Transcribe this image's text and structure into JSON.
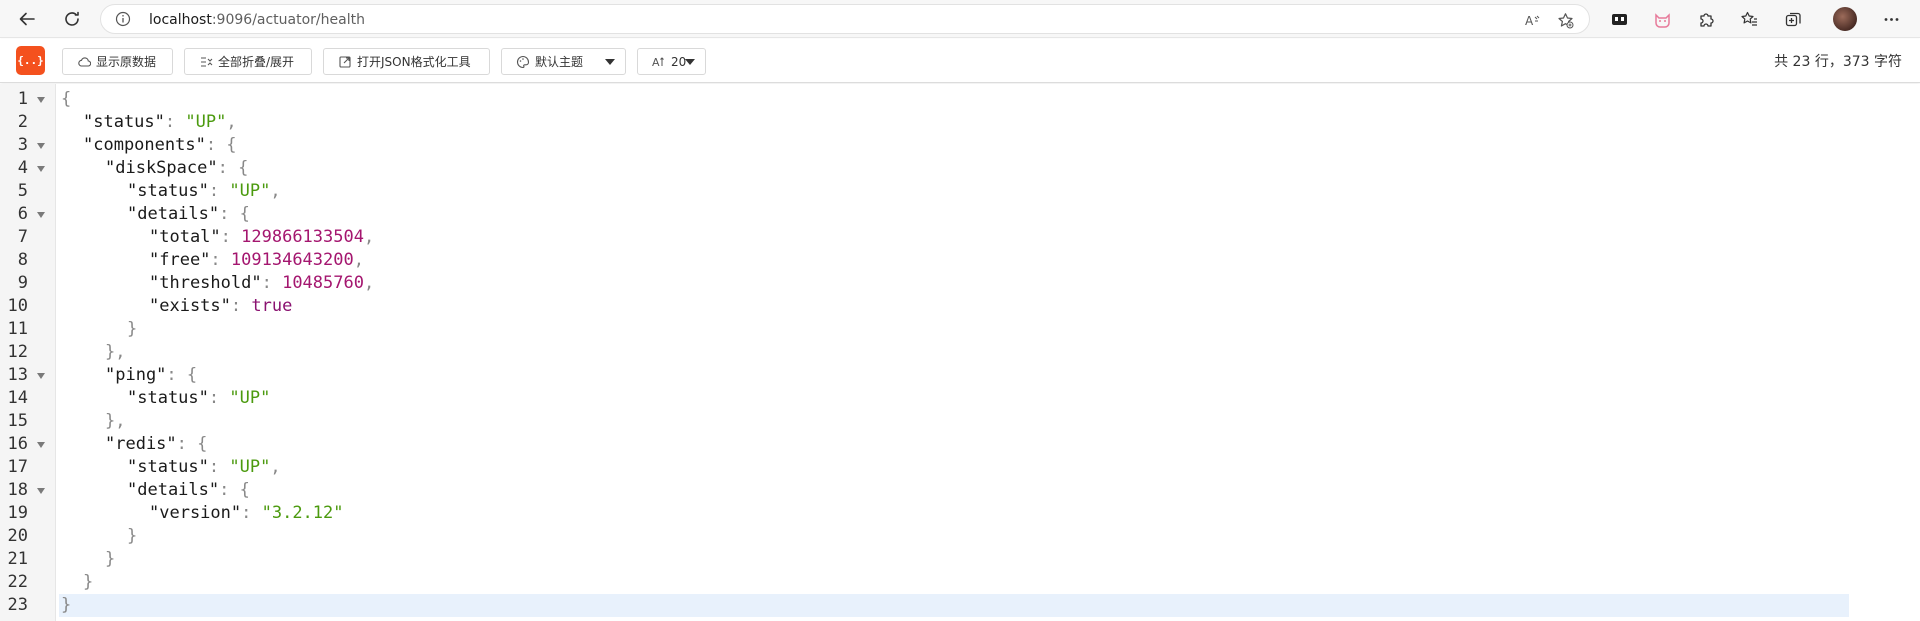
{
  "browser": {
    "url_host": "localhost",
    "url_path": ":9096/actuator/health"
  },
  "toolbar": {
    "logo_text": "{..}",
    "raw_data_label": "显示原数据",
    "fold_all_label": "全部折叠/展开",
    "open_tool_label": "打开JSON格式化工具",
    "theme_label": "默认主题",
    "font_size_label": "20",
    "stats": "共 23 行，373 字符"
  },
  "editor": {
    "active_line": 23,
    "lines": [
      {
        "num": "1",
        "fold": true,
        "indent": 0,
        "parts": [
          {
            "t": "{",
            "c": "p"
          }
        ]
      },
      {
        "num": "2",
        "fold": false,
        "indent": 1,
        "parts": [
          {
            "t": "\"status\"",
            "c": "k"
          },
          {
            "t": ": ",
            "c": "p"
          },
          {
            "t": "\"UP\"",
            "c": "s"
          },
          {
            "t": ",",
            "c": "p"
          }
        ]
      },
      {
        "num": "3",
        "fold": true,
        "indent": 1,
        "parts": [
          {
            "t": "\"components\"",
            "c": "k"
          },
          {
            "t": ": {",
            "c": "p"
          }
        ]
      },
      {
        "num": "4",
        "fold": true,
        "indent": 2,
        "parts": [
          {
            "t": "\"diskSpace\"",
            "c": "k"
          },
          {
            "t": ": {",
            "c": "p"
          }
        ]
      },
      {
        "num": "5",
        "fold": false,
        "indent": 3,
        "parts": [
          {
            "t": "\"status\"",
            "c": "k"
          },
          {
            "t": ": ",
            "c": "p"
          },
          {
            "t": "\"UP\"",
            "c": "s"
          },
          {
            "t": ",",
            "c": "p"
          }
        ]
      },
      {
        "num": "6",
        "fold": true,
        "indent": 3,
        "parts": [
          {
            "t": "\"details\"",
            "c": "k"
          },
          {
            "t": ": {",
            "c": "p"
          }
        ]
      },
      {
        "num": "7",
        "fold": false,
        "indent": 4,
        "parts": [
          {
            "t": "\"total\"",
            "c": "k"
          },
          {
            "t": ": ",
            "c": "p"
          },
          {
            "t": "129866133504",
            "c": "n"
          },
          {
            "t": ",",
            "c": "p"
          }
        ]
      },
      {
        "num": "8",
        "fold": false,
        "indent": 4,
        "parts": [
          {
            "t": "\"free\"",
            "c": "k"
          },
          {
            "t": ": ",
            "c": "p"
          },
          {
            "t": "109134643200",
            "c": "n"
          },
          {
            "t": ",",
            "c": "p"
          }
        ]
      },
      {
        "num": "9",
        "fold": false,
        "indent": 4,
        "parts": [
          {
            "t": "\"threshold\"",
            "c": "k"
          },
          {
            "t": ": ",
            "c": "p"
          },
          {
            "t": "10485760",
            "c": "n"
          },
          {
            "t": ",",
            "c": "p"
          }
        ]
      },
      {
        "num": "10",
        "fold": false,
        "indent": 4,
        "parts": [
          {
            "t": "\"exists\"",
            "c": "k"
          },
          {
            "t": ": ",
            "c": "p"
          },
          {
            "t": "true",
            "c": "b"
          }
        ]
      },
      {
        "num": "11",
        "fold": false,
        "indent": 3,
        "parts": [
          {
            "t": "}",
            "c": "p"
          }
        ]
      },
      {
        "num": "12",
        "fold": false,
        "indent": 2,
        "parts": [
          {
            "t": "},",
            "c": "p"
          }
        ]
      },
      {
        "num": "13",
        "fold": true,
        "indent": 2,
        "parts": [
          {
            "t": "\"ping\"",
            "c": "k"
          },
          {
            "t": ": {",
            "c": "p"
          }
        ]
      },
      {
        "num": "14",
        "fold": false,
        "indent": 3,
        "parts": [
          {
            "t": "\"status\"",
            "c": "k"
          },
          {
            "t": ": ",
            "c": "p"
          },
          {
            "t": "\"UP\"",
            "c": "s"
          }
        ]
      },
      {
        "num": "15",
        "fold": false,
        "indent": 2,
        "parts": [
          {
            "t": "},",
            "c": "p"
          }
        ]
      },
      {
        "num": "16",
        "fold": true,
        "indent": 2,
        "parts": [
          {
            "t": "\"redis\"",
            "c": "k"
          },
          {
            "t": ": {",
            "c": "p"
          }
        ]
      },
      {
        "num": "17",
        "fold": false,
        "indent": 3,
        "parts": [
          {
            "t": "\"status\"",
            "c": "k"
          },
          {
            "t": ": ",
            "c": "p"
          },
          {
            "t": "\"UP\"",
            "c": "s"
          },
          {
            "t": ",",
            "c": "p"
          }
        ]
      },
      {
        "num": "18",
        "fold": true,
        "indent": 3,
        "parts": [
          {
            "t": "\"details\"",
            "c": "k"
          },
          {
            "t": ": {",
            "c": "p"
          }
        ]
      },
      {
        "num": "19",
        "fold": false,
        "indent": 4,
        "parts": [
          {
            "t": "\"version\"",
            "c": "k"
          },
          {
            "t": ": ",
            "c": "p"
          },
          {
            "t": "\"3.2.12\"",
            "c": "s"
          }
        ]
      },
      {
        "num": "20",
        "fold": false,
        "indent": 3,
        "parts": [
          {
            "t": "}",
            "c": "p"
          }
        ]
      },
      {
        "num": "21",
        "fold": false,
        "indent": 2,
        "parts": [
          {
            "t": "}",
            "c": "p"
          }
        ]
      },
      {
        "num": "22",
        "fold": false,
        "indent": 1,
        "parts": [
          {
            "t": "}",
            "c": "p"
          }
        ]
      },
      {
        "num": "23",
        "fold": false,
        "indent": 0,
        "parts": [
          {
            "t": "}",
            "c": "p"
          }
        ]
      }
    ]
  },
  "colors": {
    "accent": "#f4511e",
    "string": "#4b9a0e",
    "number": "#a4166f",
    "active_line": "#e8f1fc"
  }
}
